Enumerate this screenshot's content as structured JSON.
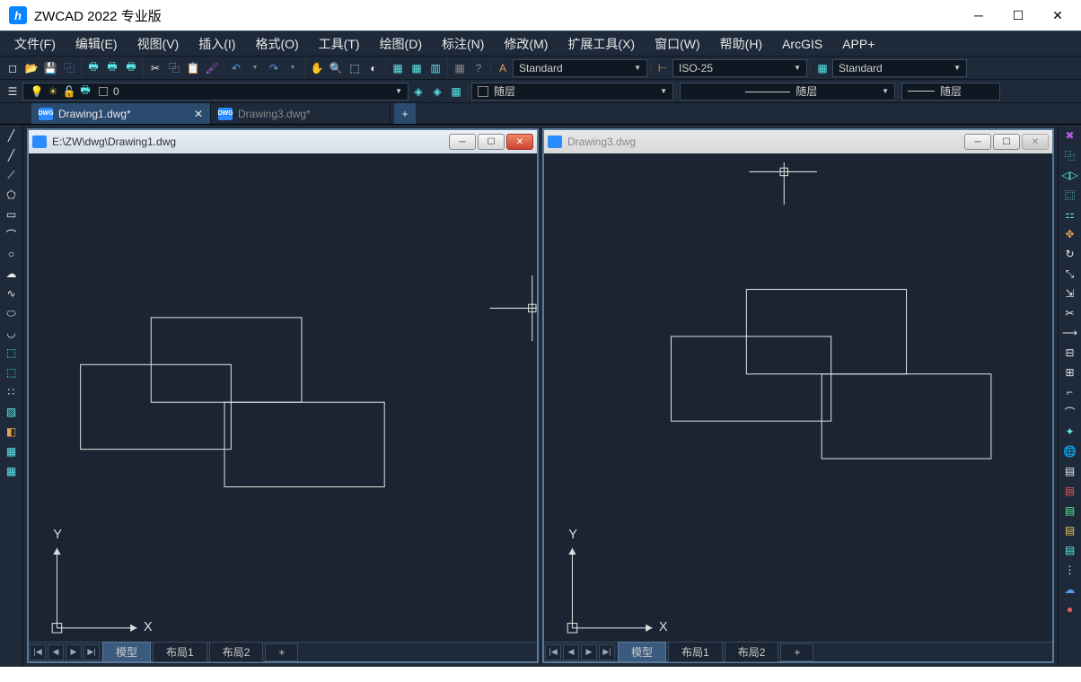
{
  "app": {
    "title": "ZWCAD 2022 专业版"
  },
  "menu": {
    "items": [
      "文件(F)",
      "编辑(E)",
      "视图(V)",
      "插入(I)",
      "格式(O)",
      "工具(T)",
      "绘图(D)",
      "标注(N)",
      "修改(M)",
      "扩展工具(X)",
      "窗口(W)",
      "帮助(H)",
      "ArcGIS",
      "APP+"
    ]
  },
  "combos": {
    "textstyle": "Standard",
    "dimstyle": "ISO-25",
    "tablestyle": "Standard",
    "layer_number": "0",
    "prop1": "随层",
    "prop2": "随层",
    "prop3": "随层"
  },
  "doctabs": [
    {
      "name": "Drawing1.dwg*",
      "active": true
    },
    {
      "name": "Drawing3.dwg*",
      "active": false
    }
  ],
  "drawings": [
    {
      "title": "E:\\ZW\\dwg\\Drawing1.dwg",
      "active": true
    },
    {
      "title": "Drawing3.dwg",
      "active": false
    }
  ],
  "layout_tabs": {
    "model": "模型",
    "layout1": "布局1",
    "layout2": "布局2",
    "add": "+"
  },
  "axis": {
    "x": "X",
    "y": "Y"
  }
}
